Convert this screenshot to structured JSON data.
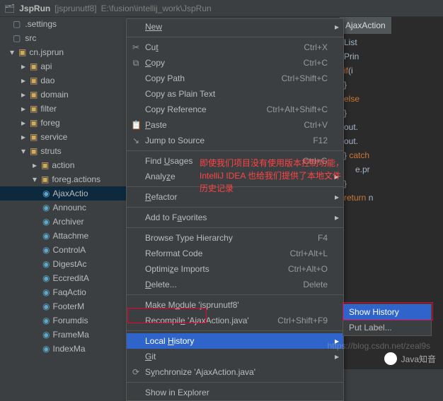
{
  "header": {
    "project": "JspRun",
    "branch": "[jsprunutf8]",
    "path": "E:\\fusion\\intellij_work\\JspRun"
  },
  "rows": {
    "settings": ".settings",
    "src": "src"
  },
  "tree": {
    "root_pkg": "cn.jsprun",
    "items": [
      "api",
      "dao",
      "domain",
      "filter",
      "foreg",
      "service",
      "struts"
    ],
    "struts_children": [
      "action",
      "foreg.actions"
    ],
    "files": [
      "AjaxActio",
      "Announc",
      "Archiver",
      "Attachme",
      "ControlA",
      "DigestAc",
      "EccreditA",
      "FaqActio",
      "FooterM",
      "Forumdis",
      "FrameMa",
      "IndexMa"
    ]
  },
  "editor": {
    "tab": "AjaxAction",
    "code": [
      "List",
      "Prin",
      "if(i",
      "",
      "}",
      "else",
      "",
      "}",
      "out.",
      "out.",
      "} catch",
      "e.pr",
      "}",
      "return n"
    ]
  },
  "menu": {
    "new": "New",
    "cut": "Cut",
    "cut_sc": "Ctrl+X",
    "copy": "Copy",
    "copy_sc": "Ctrl+C",
    "copy_path": "Copy Path",
    "copy_path_sc": "Ctrl+Shift+C",
    "copy_plain": "Copy as Plain Text",
    "copy_ref": "Copy Reference",
    "copy_ref_sc": "Ctrl+Alt+Shift+C",
    "paste": "Paste",
    "paste_sc": "Ctrl+V",
    "jump": "Jump to Source",
    "jump_sc": "F12",
    "find": "Find Usages",
    "find_sc": "Ctrl+G",
    "analyze": "Analyze",
    "refactor": "Refactor",
    "fav": "Add to Favorites",
    "browse": "Browse Type Hierarchy",
    "browse_sc": "F4",
    "reformat": "Reformat Code",
    "reformat_sc": "Ctrl+Alt+L",
    "optimize": "Optimize Imports",
    "optimize_sc": "Ctrl+Alt+O",
    "delete": "Delete...",
    "delete_sc": "Delete",
    "make": "Make Module 'jsprunutf8'",
    "recompile": "Recompile 'AjaxAction.java'",
    "recompile_sc": "Ctrl+Shift+F9",
    "local_history": "Local History",
    "git": "Git",
    "sync": "Synchronize 'AjaxAction.java'",
    "explorer": "Show in Explorer"
  },
  "submenu": {
    "show": "Show History",
    "put": "Put Label..."
  },
  "annotation": {
    "l1": "即使我们项目没有使用版本控制功能，",
    "l2": "IntelliJ IDEA 也给我们提供了本地文件",
    "l3": "历史记录"
  },
  "watermark": {
    "text": "Java知音",
    "url": "https://blog.csdn.net/zeal9s"
  }
}
